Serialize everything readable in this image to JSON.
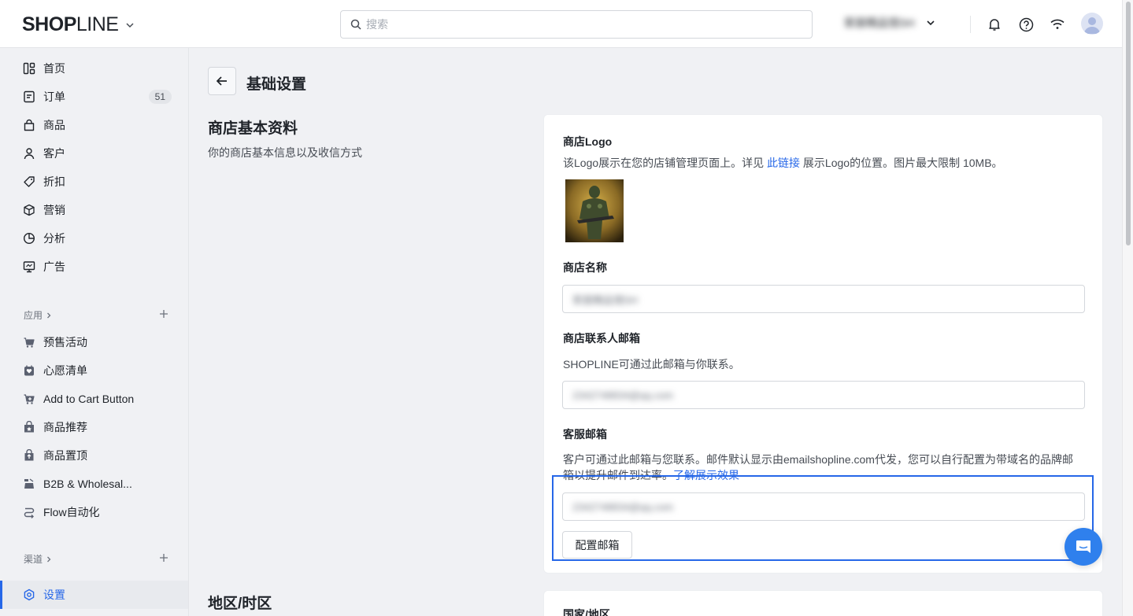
{
  "app": {
    "brand_bold": "SH",
    "brand_o": "O",
    "brand_rest_bold": "P",
    "brand_light": "LINE",
    "store_name": "家居精品馆SH",
    "colors": {
      "accent": "#2667e8",
      "chat": "#2f80ed"
    }
  },
  "search": {
    "placeholder": "搜索"
  },
  "sidebar": {
    "items": [
      {
        "label": "首页",
        "icon": "dashboard-icon"
      },
      {
        "label": "订单",
        "icon": "order-icon",
        "badge": "51"
      },
      {
        "label": "商品",
        "icon": "bag-icon"
      },
      {
        "label": "客户",
        "icon": "person-icon"
      },
      {
        "label": "折扣",
        "icon": "tag-icon"
      },
      {
        "label": "营销",
        "icon": "cube-icon"
      },
      {
        "label": "分析",
        "icon": "pie-chart-icon"
      },
      {
        "label": "广告",
        "icon": "monitor-icon"
      }
    ],
    "apps_section": "应用",
    "apps": [
      {
        "label": "预售活动",
        "icon": "presale-icon"
      },
      {
        "label": "心愿清单",
        "icon": "wishlist-icon"
      },
      {
        "label": "Add to Cart Button",
        "icon": "cart-icon"
      },
      {
        "label": "商品推荐",
        "icon": "recommend-icon"
      },
      {
        "label": "商品置顶",
        "icon": "pin-icon"
      },
      {
        "label": "B2B & Wholesal...",
        "icon": "b2b-icon"
      },
      {
        "label": "Flow自动化",
        "icon": "flow-icon"
      }
    ],
    "channels_section": "渠道",
    "settings": {
      "label": "设置",
      "icon": "gear-icon"
    }
  },
  "main": {
    "page_title": "基础设置",
    "store_section": {
      "title": "商店基本资料",
      "desc": "你的商店基本信息以及收信方式"
    },
    "logo": {
      "label": "商店Logo",
      "help_prefix": "该Logo展示在您的店铺管理页面上。详见 ",
      "help_link": "此链接",
      "help_suffix": " 展示Logo的位置。图片最大限制 10MB。"
    },
    "store_name": {
      "label": "商店名称",
      "value": "家居精品馆SH"
    },
    "contact_email": {
      "label": "商店联系人邮箱",
      "help": "SHOPLINE可通过此邮箱与你联系。",
      "value": "2342748834@qq.com"
    },
    "service_email": {
      "label": "客服邮箱",
      "help_line1": "客户可通过此邮箱与您联系。邮件默认显示由emailshopline.com代发，您可以自行配置为带域名的品牌邮",
      "help_line2": "箱以提升邮件到达率。",
      "help_link": "了解展示效果",
      "value": "2342748834@qq.com",
      "button": "配置邮箱"
    },
    "region_section": {
      "title": "地区/时区",
      "country_label": "国家/地区"
    }
  }
}
